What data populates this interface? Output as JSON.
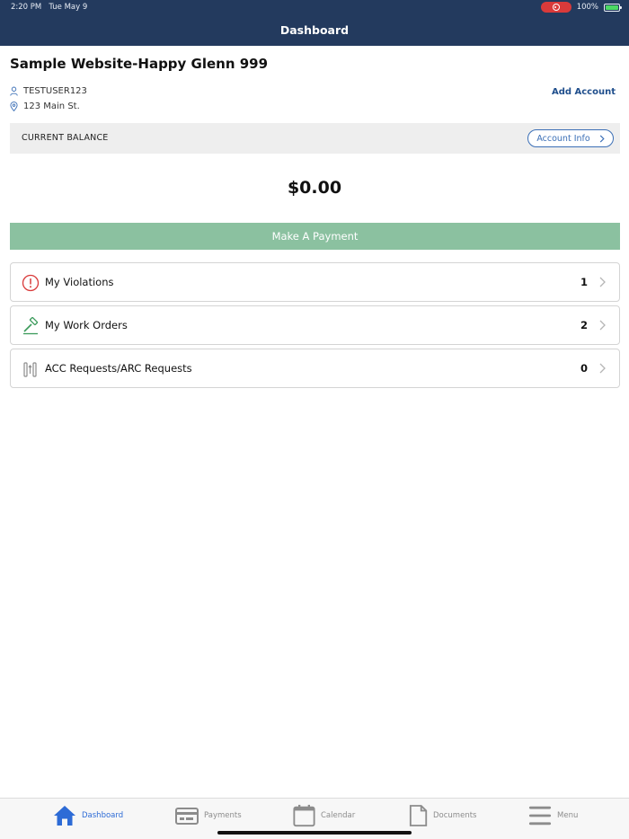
{
  "status_bar": {
    "time": "2:20 PM",
    "date": "Tue May 9",
    "battery": "100%"
  },
  "nav": {
    "title": "Dashboard"
  },
  "account": {
    "site_title": "Sample Website-Happy Glenn 999",
    "username": "TESTUSER123",
    "address": "123 Main St.",
    "add_account_label": "Add Account"
  },
  "balance": {
    "label": "CURRENT BALANCE",
    "account_info_label": "Account Info",
    "amount": "$0.00"
  },
  "payment_button_label": "Make A Payment",
  "items": [
    {
      "label": "My Violations",
      "count": "1",
      "icon": "alert-circle-icon"
    },
    {
      "label": "My Work Orders",
      "count": "2",
      "icon": "hammer-icon"
    },
    {
      "label": "ACC Requests/ARC Requests",
      "count": "0",
      "icon": "tools-icon"
    }
  ],
  "tabs": [
    {
      "label": "Dashboard",
      "icon": "home-icon",
      "active": true
    },
    {
      "label": "Payments",
      "icon": "card-icon",
      "active": false
    },
    {
      "label": "Calendar",
      "icon": "calendar-icon",
      "active": false
    },
    {
      "label": "Documents",
      "icon": "document-icon",
      "active": false
    },
    {
      "label": "Menu",
      "icon": "menu-icon",
      "active": false
    }
  ],
  "colors": {
    "header": "#233a5e",
    "accent": "#2d6bd6",
    "pay_button": "#8bc1a0",
    "violation": "#d93a3a",
    "work_order": "#3a9a5a"
  }
}
